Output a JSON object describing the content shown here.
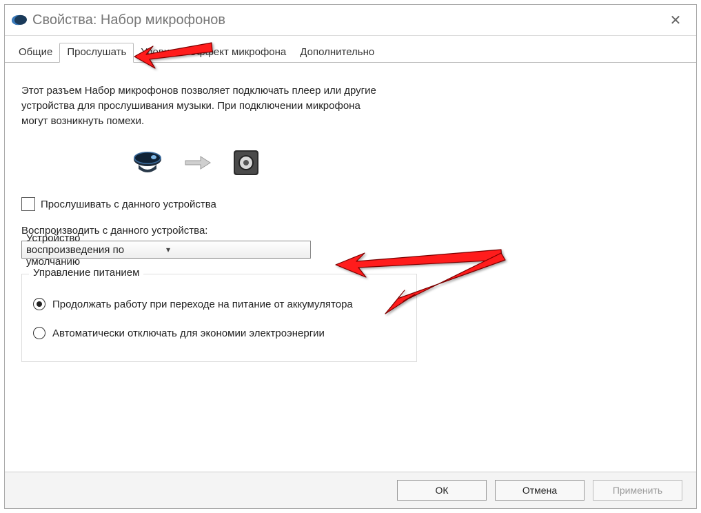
{
  "window": {
    "title": "Свойства: Набор микрофонов"
  },
  "tabs": {
    "general": "Общие",
    "listen": "Прослушать",
    "levels": "Уровни",
    "effect": "Эффект микрофона",
    "advanced": "Дополнительно"
  },
  "body": {
    "description": "Этот разъем Набор микрофонов позволяет подключать плеер или другие устройства для прослушивания музыки. При подключении микрофона могут возникнуть помехи.",
    "listen_checkbox": "Прослушивать с данного устройства",
    "playback_label": "Воспроизводить с данного устройства:",
    "playback_value": "Устройство воспроизведения по умолчанию",
    "group_title": "Управление питанием",
    "radio_continue": "Продолжать работу при переходе на питание от аккумулятора",
    "radio_auto_off": "Автоматически отключать для экономии электроэнергии"
  },
  "buttons": {
    "ok": "ОК",
    "cancel": "Отмена",
    "apply": "Применить"
  }
}
